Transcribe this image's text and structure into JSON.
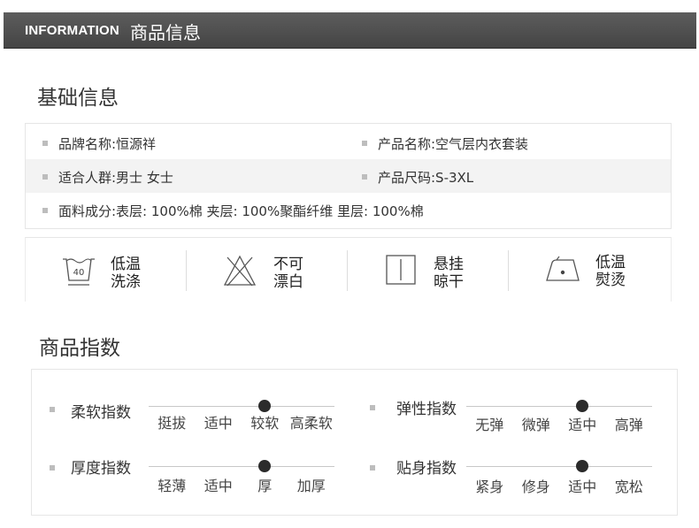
{
  "header": {
    "en_title": "INFORMATION",
    "cn_title": "商品信息"
  },
  "basic_info": {
    "title": "基础信息",
    "brand": "品牌名称:恒源祥",
    "product_name": "产品名称:空气层内衣套装",
    "audience": "适合人群:男士 女士",
    "size": "产品尺码:S-3XL",
    "fabric": "面料成分:表层: 100%棉 夹层: 100%聚酯纤维 里层: 100%棉"
  },
  "care": [
    {
      "icon": "wash-40-icon",
      "icon_text": "40",
      "line1": "低温",
      "line2": "洗涤"
    },
    {
      "icon": "no-bleach-icon",
      "line1": "不可",
      "line2": "漂白"
    },
    {
      "icon": "hang-dry-icon",
      "line1": "悬挂",
      "line2": "晾干"
    },
    {
      "icon": "low-iron-icon",
      "line1": "低温",
      "line2": "熨烫"
    }
  ],
  "indices": {
    "title": "商品指数",
    "items": [
      {
        "label": "柔软指数",
        "options": [
          "挺拔",
          "适中",
          "较软",
          "高柔软"
        ],
        "selected": 2
      },
      {
        "label": "弹性指数",
        "options": [
          "无弹",
          "微弹",
          "适中",
          "高弹"
        ],
        "selected": 2
      },
      {
        "label": "厚度指数",
        "options": [
          "轻薄",
          "适中",
          "厚",
          "加厚"
        ],
        "selected": 2
      },
      {
        "label": "贴身指数",
        "options": [
          "紧身",
          "修身",
          "适中",
          "宽松"
        ],
        "selected": 2
      }
    ]
  }
}
